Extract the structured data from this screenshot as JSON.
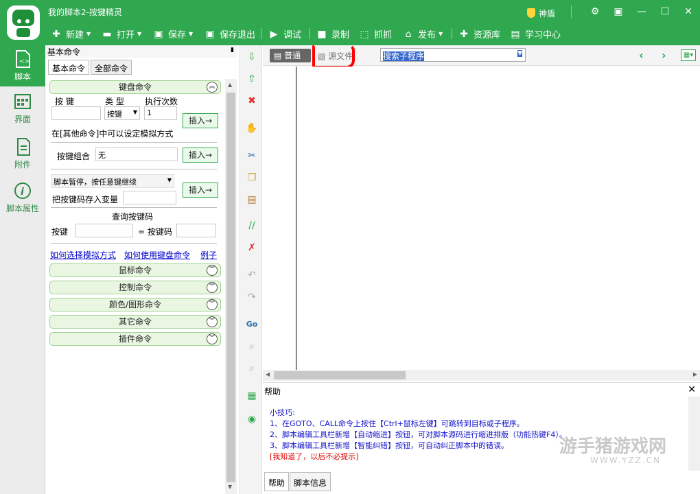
{
  "window": {
    "title": "我的脚本2-按键精灵",
    "shield_label": "神盾"
  },
  "toolbar": {
    "items": [
      {
        "label": "新建",
        "icon": "plus-icon"
      },
      {
        "label": "打开",
        "icon": "folder-icon"
      },
      {
        "label": "保存",
        "icon": "save-icon"
      },
      {
        "label": "保存退出",
        "icon": "save-exit-icon"
      },
      {
        "label": "调试",
        "icon": "play-icon"
      },
      {
        "label": "录制",
        "icon": "camera-icon"
      },
      {
        "label": "抓抓",
        "icon": "capture-icon"
      },
      {
        "label": "发布",
        "icon": "publish-icon"
      },
      {
        "label": "资源库",
        "icon": "resource-icon"
      },
      {
        "label": "学习中心",
        "icon": "book-icon"
      }
    ]
  },
  "leftnav": {
    "items": [
      {
        "label": "脚本",
        "icon": "script-icon"
      },
      {
        "label": "界面",
        "icon": "ui-icon"
      },
      {
        "label": "附件",
        "icon": "attachment-icon"
      },
      {
        "label": "脚本属性",
        "icon": "info-icon"
      }
    ]
  },
  "panel": {
    "header": "基本命令",
    "tabs": [
      "基本命令",
      "全部命令"
    ],
    "keyboard": {
      "title": "键盘命令",
      "col_key": "按 键",
      "col_type": "类 型",
      "col_count": "执行次数",
      "type_value": "按键",
      "count_value": "1",
      "insert": "插入→",
      "note": "在[其他命令]中可以设定模拟方式",
      "combo_label": "按键组合",
      "combo_value": "无",
      "pause_value": "脚本暂停，按任意键继续",
      "store_label": "把按键码存入变量",
      "query_title": "查询按键码",
      "query_key": "按键",
      "query_code": "= 按键码"
    },
    "links": [
      "如何选择模拟方式",
      "如何使用键盘命令",
      "例子"
    ],
    "groups": [
      "鼠标命令",
      "控制命令",
      "颜色/图形命令",
      "其它命令",
      "插件命令"
    ]
  },
  "editor": {
    "view_normal": "普通",
    "view_source": "源文件",
    "search_placeholder": "搜索子程序"
  },
  "help": {
    "title": "帮助",
    "lines": [
      "小技巧:",
      "1、在GOTO、CALL命令上按住【Ctrl+鼠标左键】可跳转到目标或子程序。",
      "2、脚本编辑工具栏新增【自动缩进】按钮，可对脚本源码进行缩进排版（功能热键F4）。",
      "3、脚本编辑工具栏新增【智能纠错】按钮，可自动纠正脚本中的错误。"
    ],
    "dismiss": "[我知道了，以后不必提示]",
    "tabs": [
      "帮助",
      "脚本信息"
    ]
  },
  "watermark": {
    "text": "游手猪游戏网",
    "url": "WWW.YZZ.CN"
  },
  "colors": {
    "brand": "#2fa84f",
    "link": "#0000cc",
    "help_text": "#1111cc",
    "alert": "#e00000"
  }
}
